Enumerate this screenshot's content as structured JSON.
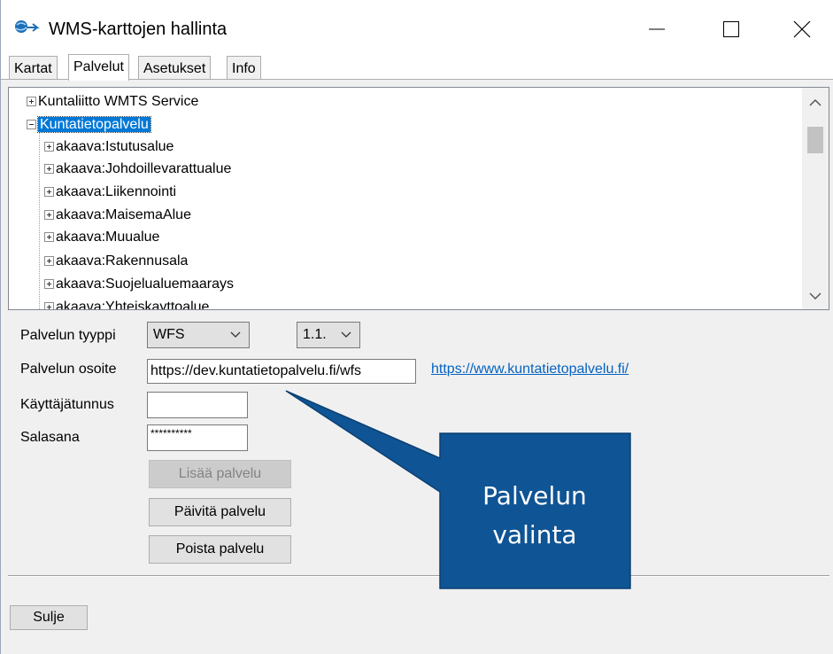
{
  "window": {
    "title": "WMS-karttojen hallinta",
    "accent": "#0078d7"
  },
  "tabs": [
    {
      "label": "Kartat"
    },
    {
      "label": "Palvelut",
      "active": true
    },
    {
      "label": "Asetukset"
    },
    {
      "label": "Info"
    }
  ],
  "tree": {
    "nodes": [
      {
        "label": "Kuntaliitto WMTS Service",
        "level": 0,
        "expanded": false
      },
      {
        "label": "Kuntatietopalvelu",
        "level": 0,
        "expanded": true,
        "selected": true
      },
      {
        "label": "akaava:Istutusalue",
        "level": 1
      },
      {
        "label": "akaava:Johdoillevarattualue",
        "level": 1
      },
      {
        "label": "akaava:Liikennointi",
        "level": 1
      },
      {
        "label": "akaava:MaisemaAlue",
        "level": 1
      },
      {
        "label": "akaava:Muualue",
        "level": 1
      },
      {
        "label": "akaava:Rakennusala",
        "level": 1
      },
      {
        "label": "akaava:Suojelualuemaarays",
        "level": 1
      },
      {
        "label": "akaava:Yhteiskayttoalue",
        "level": 1
      }
    ]
  },
  "form": {
    "type_label": "Palvelun tyyppi",
    "type_value": "WFS",
    "version_value": "1.1.",
    "address_label": "Palvelun osoite",
    "address_value": "https://dev.kuntatietopalvelu.fi/wfs",
    "link_text": "https://www.kuntatietopalvelu.fi/",
    "username_label": "Käyttäjätunnus",
    "username_value": "",
    "password_label": "Salasana",
    "password_value": "**********",
    "add_button": "Lisää palvelu",
    "update_button": "Päivitä palvelu",
    "delete_button": "Poista palvelu"
  },
  "footer": {
    "close_button": "Sulje"
  },
  "callout": {
    "line1": "Palvelun",
    "line2": "valinta",
    "fill": "#0f5494"
  }
}
